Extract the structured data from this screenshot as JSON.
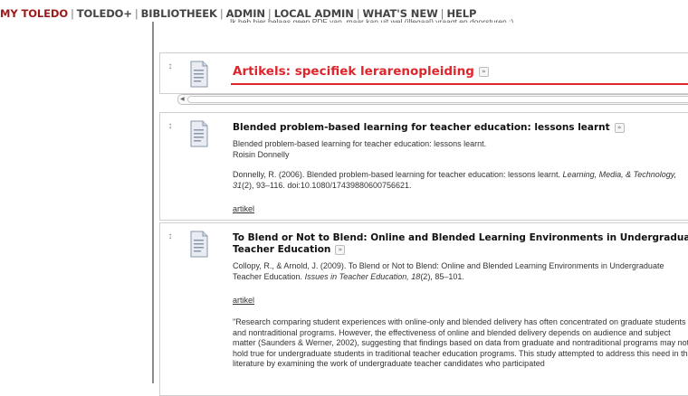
{
  "nav": {
    "items": [
      {
        "label": "MY TOLEDO",
        "active": true
      },
      {
        "label": "TOLEDO+"
      },
      {
        "label": "BIBLIOTHEEK"
      },
      {
        "label": "ADMIN"
      },
      {
        "label": "LOCAL ADMIN"
      },
      {
        "label": "WHAT'S NEW"
      },
      {
        "label": "HELP"
      }
    ]
  },
  "cutoff_text": "Ik heb hier helaas geen PDF van, maar kan uit wel (illegaal) vraagt en doorsturen ;)",
  "section": {
    "title": "Artikels: specifiek lerarenopleiding",
    "chevron": "»"
  },
  "items": [
    {
      "title": "Blended problem-based learning for teacher education: lessons learnt",
      "chevron": "»",
      "desc_line1": "Blended problem-based learning for teacher education: lessons learnt.",
      "desc_line2": "Roisin Donnelly",
      "citation_a": "Donnelly, R. (2006). Blended problem-based learning for teacher education: lessons learnt. ",
      "citation_journal": "Learning, Media, & Technology, 31",
      "citation_b": "(2), 93–116. doi:10.1080/17439880600756621.",
      "link": "artikel"
    },
    {
      "title_line1": "To Blend or Not to Blend: Online and Blended Learning Environments in Undergraduate",
      "title_line2": "Teacher Education",
      "chevron": "»",
      "citation_a": "Collopy, R., & Arnold, J. (2009). To Blend or Not to Blend: Online and Blended Learning Environments in Undergraduate Teacher Education. ",
      "citation_journal": "Issues in Teacher Education, 18",
      "citation_b": "(2), 85–101.",
      "link": "artikel",
      "abstract": "\"Research comparing student experiences with online-only and blended delivery has often concentrated on graduate students and nontraditional programs. However, the effectiveness of online and blended delivery depends on audience and subject matter (Saunders & Werner, 2002), suggesting that findings based on data from graduate and nontraditional programs may not hold true for undergraduate students in traditional teacher education programs. This study attempted to address this need in the literature by examining the work of undergraduate teacher candidates who participated"
    }
  ],
  "icons": {
    "handle": "drag-handle-icon",
    "document": "document-icon",
    "chevron": "chevron-down-icon",
    "scroll_left": "scroll-left-arrow-icon"
  },
  "colors": {
    "nav_active": "#9a1b1b",
    "section_red": "#e0242b"
  }
}
